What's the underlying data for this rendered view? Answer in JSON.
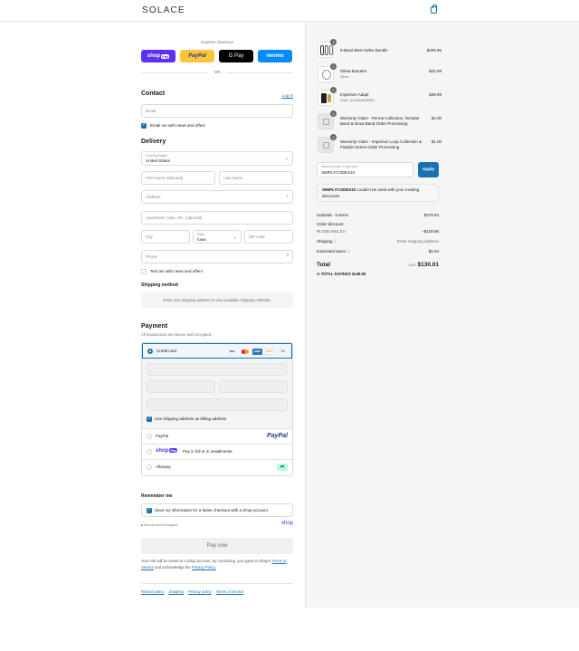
{
  "header": {
    "brand": "SOLACE",
    "cart_icon": "shopping-bag-icon"
  },
  "express": {
    "title": "Express checkout",
    "buttons": [
      {
        "label": "shop",
        "badge": "Pay",
        "bg": "#5a31f4",
        "fg": "#ffffff"
      },
      {
        "label": "PayPal",
        "bg": "#ffc439",
        "fg": "#253b80"
      },
      {
        "label": "G Pay",
        "bg": "#000000",
        "fg": "#ffffff"
      },
      {
        "label": "venmo",
        "bg": "#008cff",
        "fg": "#ffffff"
      }
    ],
    "or": "OR"
  },
  "contact": {
    "title": "Contact",
    "login": "Log in",
    "email_placeholder": "Email",
    "email_news": "Email me with news and offers"
  },
  "delivery": {
    "title": "Delivery",
    "country_label": "Country/Region",
    "country_value": "United States",
    "first_name": "First name (optional)",
    "last_name": "Last name",
    "address": "Address",
    "apartment": "Apartment, suite, etc. (optional)",
    "city": "City",
    "state_label": "State",
    "state_value": "Iowa",
    "zip": "ZIP code",
    "phone": "Phone",
    "text_news": "Text me with news and offers"
  },
  "shipping_method": {
    "title": "Shipping method",
    "note": "Enter your shipping address to view available shipping methods."
  },
  "payment": {
    "title": "Payment",
    "subtitle": "All transactions are secure and encrypted.",
    "credit_card": "Credit card",
    "card_more": "+4",
    "billing_same": "Use shipping address as billing address",
    "paypal": "PayPal",
    "paypal_logo": "PayPal",
    "shoppay_text": "Pay in full or in installments",
    "afterpay": "Afterpay"
  },
  "remember": {
    "title": "Remember me",
    "save_info": "Save my information for a faster checkout with a Shop account",
    "secure": "Secure and encrypted",
    "shop": "shop"
  },
  "pay_now": "Pay now",
  "legal": {
    "text": "Your info will be saved to a Shop account. By continuing, you agree to Shop’s",
    "terms": "Terms of Service",
    "and": "and acknowledge the",
    "privacy": "Privacy Policy."
  },
  "footer_links": [
    "Refund policy",
    "Shipping",
    "Privacy policy",
    "Terms of service"
  ],
  "cart": {
    "items": [
      {
        "name": "5-Band Best Seller Bundle",
        "sub": "",
        "qty": "3",
        "price": "$209.95"
      },
      {
        "name": "Olivia Bracelet",
        "sub": "Silver",
        "qty": "1",
        "price": "$24.99"
      },
      {
        "name": "Imperium Adapt",
        "sub": "Gold / 44/45/46/49MM",
        "qty": "1",
        "price": "$39.99"
      },
      {
        "name": "Warranty Claim - Perma Collection, Templar Band & Nova Band Order Processing",
        "sub": "",
        "qty": "1",
        "price": "$4.00"
      },
      {
        "name": "Warranty Claim - Imperium Loop Collection & Paladin Series Order Processing",
        "sub": "",
        "qty": "1",
        "price": "$1.00"
      }
    ],
    "discount_label": "Discount code or gift card",
    "discount_value": "SIMPLYCODES10",
    "apply": "Apply",
    "error_code": "SIMPLYCODES10",
    "error_text": "couldn’t be used with your existing discounts.",
    "subtotal_label": "Subtotal · 5 items",
    "subtotal": "$279.93",
    "order_discount": "Order discount",
    "discount_code": "3XBUNDLES",
    "discount_amount": "−$149.96",
    "shipping_label": "Shipping",
    "shipping_value": "Enter shipping address",
    "taxes_label": "Estimated taxes",
    "taxes_value": "$0.04",
    "total_label": "Total",
    "currency": "USD",
    "total": "$130.01",
    "savings_label": "TOTAL SAVINGS",
    "savings": "$149.96"
  }
}
